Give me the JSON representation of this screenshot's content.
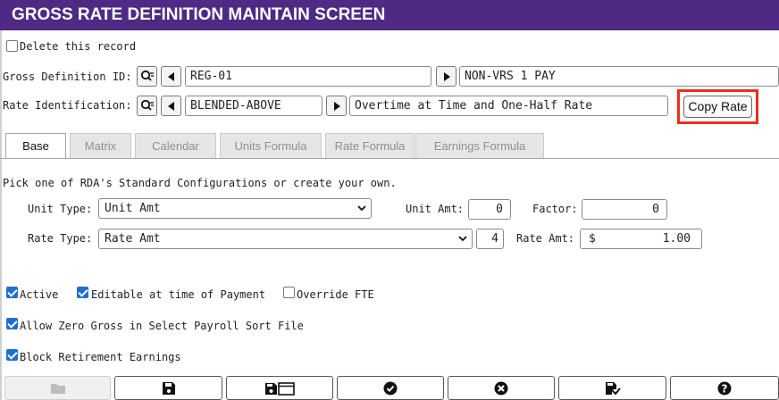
{
  "title": "GROSS RATE DEFINITION MAINTAIN SCREEN",
  "delete_record_label": "Delete this record",
  "gross_definition": {
    "label": "Gross Definition ID:",
    "id_value": "REG-01",
    "description": "NON-VRS 1 PAY"
  },
  "rate_identification": {
    "label": "Rate Identification:",
    "id_value": "BLENDED-ABOVE",
    "description": "Overtime at Time and One-Half Rate"
  },
  "copy_rate_button": "Copy Rate",
  "tabs": [
    {
      "label": "Base",
      "active": true
    },
    {
      "label": "Matrix",
      "active": false
    },
    {
      "label": "Calendar",
      "active": false
    },
    {
      "label": "Units Formula",
      "active": false
    },
    {
      "label": "Rate Formula",
      "active": false
    },
    {
      "label": "Earnings Formula",
      "active": false
    }
  ],
  "instructions": "Pick one of RDA's Standard Configurations or create your own.",
  "unit_type": {
    "label": "Unit Type:",
    "value": "Unit Amt"
  },
  "unit_amt": {
    "label": "Unit Amt:",
    "value": "0"
  },
  "factor": {
    "label": "Factor:",
    "value": "0"
  },
  "rate_type": {
    "label": "Rate Type:",
    "value": "Rate Amt",
    "code": "4"
  },
  "rate_amt": {
    "label": "Rate Amt:",
    "currency": "$",
    "value": "1.00"
  },
  "checkboxes": {
    "active": {
      "label": "Active",
      "checked": true
    },
    "editable": {
      "label": "Editable at time of Payment",
      "checked": true
    },
    "override_fte": {
      "label": "Override FTE",
      "checked": false
    },
    "allow_zero_gross": {
      "label": "Allow Zero Gross in Select Payroll Sort File",
      "checked": true
    },
    "block_retirement": {
      "label": "Block Retirement Earnings",
      "checked": true
    }
  },
  "toolbar_icons": [
    "folder-icon",
    "save-icon",
    "save-new-icon",
    "check-icon",
    "cancel-icon",
    "save-check-icon",
    "help-icon"
  ],
  "colors": {
    "title_bar": "#4e2a84",
    "highlight": "#e8311b",
    "checkbox": "#1f6fd1"
  }
}
